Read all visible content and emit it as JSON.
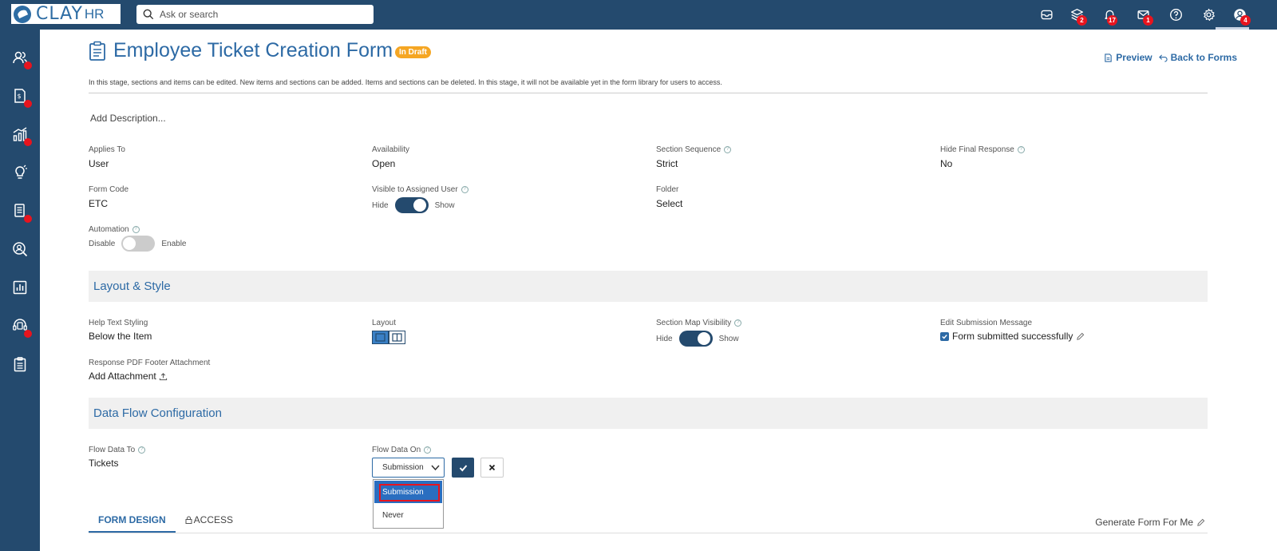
{
  "app": {
    "logo_text": "CLAY",
    "logo_sub": "HR"
  },
  "search": {
    "placeholder": "Ask or search"
  },
  "topbar": {
    "badges": {
      "layers": "2",
      "notifications": "17",
      "mail": "1",
      "profile": "4"
    }
  },
  "form": {
    "title": "Employee Ticket Creation Form",
    "status": "In Draft",
    "preview_label": "Preview",
    "back_label": "Back to Forms",
    "stage_info": "In this stage, sections and items can be edited. New items and sections can be added. Items and sections can be deleted. In this stage, it will not be available yet in the form library for users to access.",
    "add_description": "Add Description..."
  },
  "props": {
    "applies_to": {
      "label": "Applies To",
      "value": "User"
    },
    "availability": {
      "label": "Availability",
      "value": "Open"
    },
    "section_sequence": {
      "label": "Section Sequence",
      "value": "Strict"
    },
    "hide_final_response": {
      "label": "Hide Final Response",
      "value": "No"
    },
    "form_code": {
      "label": "Form Code",
      "value": "ETC"
    },
    "visible_to_assigned": {
      "label": "Visible to Assigned User",
      "off": "Hide",
      "on": "Show",
      "state": "on"
    },
    "folder": {
      "label": "Folder",
      "value": "Select"
    },
    "automation": {
      "label": "Automation",
      "off": "Disable",
      "on": "Enable",
      "state": "off"
    }
  },
  "layout_style": {
    "heading": "Layout & Style",
    "help_text_styling": {
      "label": "Help Text Styling",
      "value": "Below the Item"
    },
    "layout": {
      "label": "Layout",
      "selected": "single-column"
    },
    "section_map": {
      "label": "Section Map Visibility",
      "off": "Hide",
      "on": "Show",
      "state": "on"
    },
    "submission_message": {
      "label": "Edit Submission Message",
      "value": "Form submitted successfully",
      "checked": true
    },
    "pdf_footer": {
      "label": "Response PDF Footer Attachment",
      "value": "Add Attachment"
    }
  },
  "data_flow": {
    "heading": "Data Flow Configuration",
    "flow_to": {
      "label": "Flow Data To",
      "value": "Tickets"
    },
    "flow_on": {
      "label": "Flow Data On",
      "value": "Submission",
      "options": [
        "Submission",
        "Never"
      ]
    }
  },
  "tabs": [
    {
      "label": "FORM DESIGN"
    },
    {
      "label": "ACCESS"
    }
  ],
  "generate_label": "Generate Form For Me"
}
